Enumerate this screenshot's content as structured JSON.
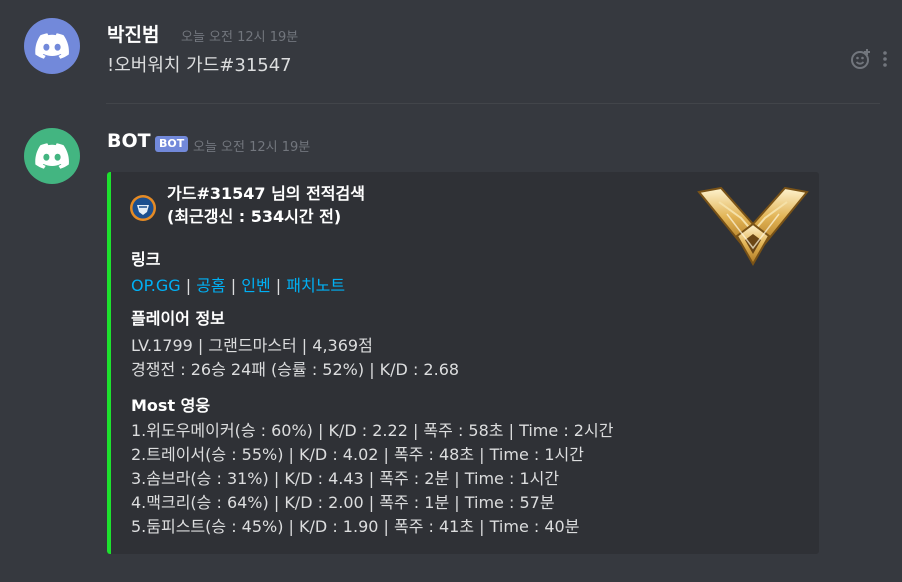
{
  "messages": [
    {
      "author": "박진범",
      "timestamp": "오늘 오전 12시 19분",
      "text": "!오버워치 가드#31547"
    },
    {
      "author": "BOT",
      "badge": "BOT",
      "timestamp": "오늘 오전 12시 19분",
      "embed": {
        "accent_color": "#1de12e",
        "title_line1": "가드#31547 님의 전적검색",
        "title_line2": "(최근갱신 : 534시간 전)",
        "fields": {
          "links_name": "링크",
          "links": [
            "OP.GG",
            "공홈",
            "인벤",
            "패치노트"
          ],
          "link_separator": " | ",
          "player_name": "플레이어 정보",
          "player_lines": [
            "LV.1799 | 그랜드마스터 | 4,369점",
            "경쟁전 : 26승 24패 (승률 : 52%) | K/D : 2.68"
          ],
          "heroes_name": "Most 영웅",
          "hero_lines": [
            "1.위도우메이커(승 : 60%) | K/D : 2.22 | 폭주 : 58초 | Time : 2시간",
            "2.트레이서(승 : 55%) | K/D : 4.02 | 폭주 : 48초 | Time : 1시간",
            "3.솜브라(승 : 31%) | K/D : 4.43 | 폭주 : 2분 | Time : 1시간",
            "4.맥크리(승 : 64%) | K/D : 2.00 | 폭주 : 1분 | Time : 57분",
            "5.둠피스트(승 : 45%) | K/D : 1.90 | 폭주 : 41초 | Time : 40분"
          ]
        }
      }
    }
  ],
  "colors": {
    "background": "#36393f",
    "embed_background": "#2f3136",
    "link": "#00b0f4",
    "avatar_user": "#7289da",
    "avatar_bot": "#43b581",
    "bot_badge": "#7289da"
  },
  "icons": [
    "discord-logo-icon",
    "add-reaction-icon",
    "more-options-icon",
    "overwatch-author-icon",
    "grandmaster-rank-icon"
  ]
}
